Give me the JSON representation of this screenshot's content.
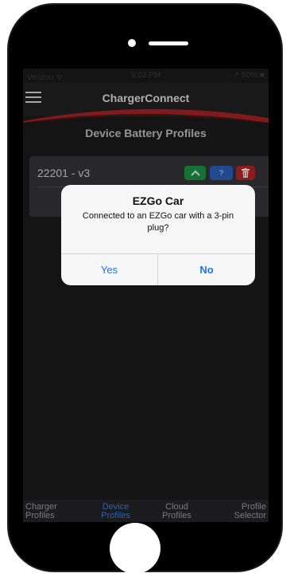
{
  "status_bar": {
    "carrier": "Verizon ᯤ",
    "time": "5:03 PM",
    "battery": "⇗ 50% ■"
  },
  "nav": {
    "menu_icon": "hamburger-menu-icon",
    "title": "ChargerConnect"
  },
  "page": {
    "title": "Device Battery Profiles"
  },
  "profiles": [
    {
      "name": "22201 - v3",
      "actions": {
        "up_icon": "chevron-up-icon",
        "help_label": "?",
        "delete_icon": "trash-icon"
      }
    }
  ],
  "dialog": {
    "title": "EZGo Car",
    "message": "Connected to an EZGo car with a 3-pin plug?",
    "yes_label": "Yes",
    "no_label": "No"
  },
  "tabs": [
    {
      "line1": "Charger",
      "line2": "Profiles",
      "active": false
    },
    {
      "line1": "Device",
      "line2": "Profiles",
      "active": true
    },
    {
      "line1": "Cloud",
      "line2": "Profiles",
      "active": false
    },
    {
      "line1": "Profile",
      "line2": "Selector",
      "active": false
    }
  ],
  "colors": {
    "accent_red": "#c62828",
    "tab_active": "#2b5fb6",
    "dialog_button": "#1f73e8",
    "btn_green": "#1e9e4a",
    "btn_blue": "#2f66c8"
  }
}
